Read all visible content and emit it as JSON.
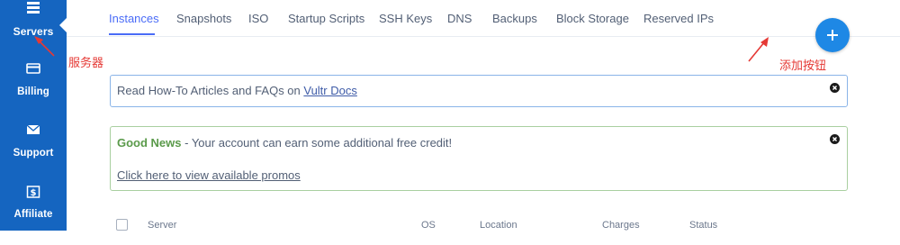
{
  "sidebar": {
    "items": [
      {
        "label": "Servers",
        "icon": "servers-icon",
        "active": true
      },
      {
        "label": "Billing",
        "icon": "billing-icon"
      },
      {
        "label": "Support",
        "icon": "support-icon"
      },
      {
        "label": "Affiliate",
        "icon": "affiliate-icon"
      }
    ]
  },
  "tabs": [
    {
      "label": "Instances",
      "active": true
    },
    {
      "label": "Snapshots"
    },
    {
      "label": "ISO"
    },
    {
      "label": "Startup Scripts"
    },
    {
      "label": "SSH Keys"
    },
    {
      "label": "DNS"
    },
    {
      "label": "Backups"
    },
    {
      "label": "Block Storage"
    },
    {
      "label": "Reserved IPs"
    }
  ],
  "add_button": {
    "icon": "plus-icon"
  },
  "annotations": {
    "servers_note": "服务器",
    "add_button_note": "添加按钮"
  },
  "notices": {
    "info": {
      "text": "Read How-To Articles and FAQs on ",
      "link": "Vultr Docs"
    },
    "promo": {
      "headline": "Good News",
      "text": " - Your account can earn some additional free credit!",
      "link": "Click here to view available promos"
    }
  },
  "table": {
    "columns": [
      "Server",
      "OS",
      "Location",
      "Charges",
      "Status"
    ]
  },
  "colors": {
    "sidebar": "#1565c0",
    "accent": "#4a6cf7",
    "add_button": "#1e88e5",
    "annotation": "#e53935",
    "good_news": "#5a9a4a"
  }
}
